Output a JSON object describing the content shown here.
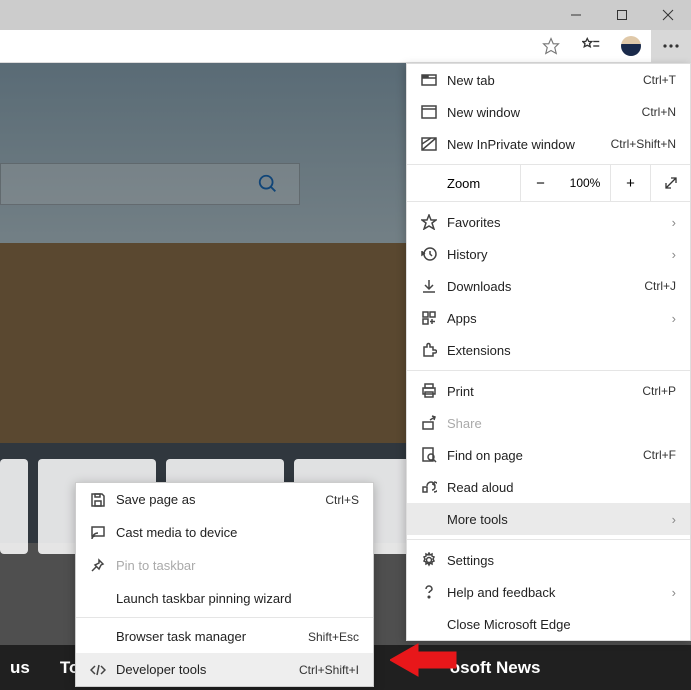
{
  "menu": {
    "new_tab": {
      "label": "New tab",
      "shortcut": "Ctrl+T"
    },
    "new_window": {
      "label": "New window",
      "shortcut": "Ctrl+N"
    },
    "inprivate": {
      "label": "New InPrivate window",
      "shortcut": "Ctrl+Shift+N"
    },
    "zoom": {
      "label": "Zoom",
      "value": "100%"
    },
    "favorites": {
      "label": "Favorites"
    },
    "history": {
      "label": "History"
    },
    "downloads": {
      "label": "Downloads",
      "shortcut": "Ctrl+J"
    },
    "apps": {
      "label": "Apps"
    },
    "extensions": {
      "label": "Extensions"
    },
    "print": {
      "label": "Print",
      "shortcut": "Ctrl+P"
    },
    "share": {
      "label": "Share"
    },
    "find": {
      "label": "Find on page",
      "shortcut": "Ctrl+F"
    },
    "read_aloud": {
      "label": "Read aloud"
    },
    "more_tools": {
      "label": "More tools"
    },
    "settings": {
      "label": "Settings"
    },
    "help": {
      "label": "Help and feedback"
    },
    "close": {
      "label": "Close Microsoft Edge"
    }
  },
  "submenu": {
    "save_page": {
      "label": "Save page as",
      "shortcut": "Ctrl+S"
    },
    "cast": {
      "label": "Cast media to device"
    },
    "pin": {
      "label": "Pin to taskbar"
    },
    "launch_pin": {
      "label": "Launch taskbar pinning wizard"
    },
    "task_manager": {
      "label": "Browser task manager",
      "shortcut": "Shift+Esc"
    },
    "devtools": {
      "label": "Developer tools",
      "shortcut": "Ctrl+Shift+I"
    }
  },
  "footer": {
    "item1": "us",
    "item2": "Top",
    "item3": "osoft News"
  }
}
